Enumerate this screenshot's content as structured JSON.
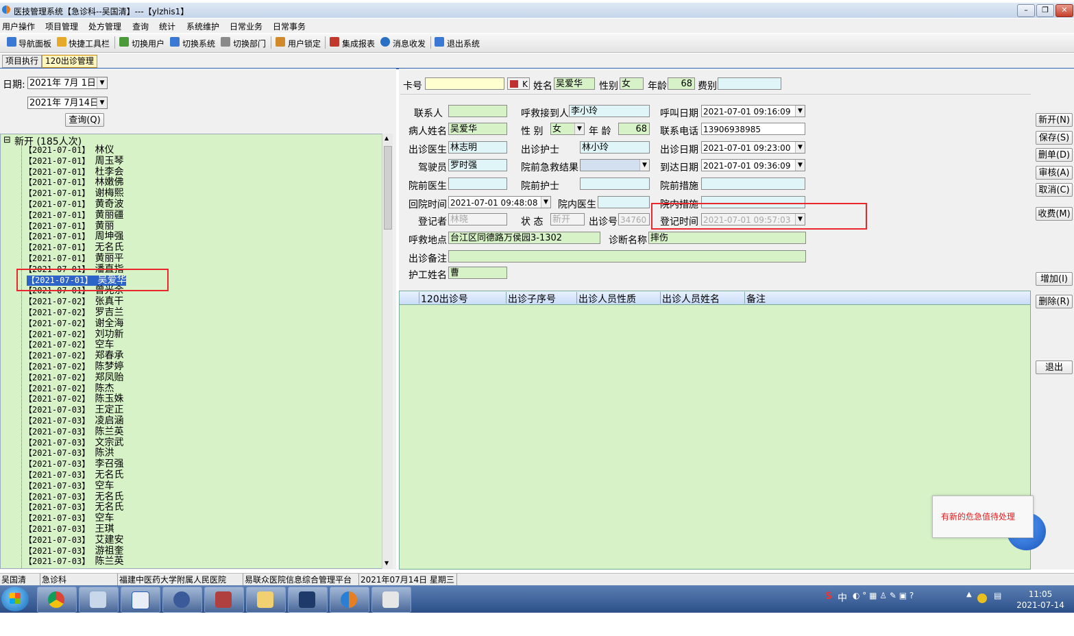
{
  "window": {
    "title": "医技管理系统【急诊科--吴国清】---【ylzhis1】"
  },
  "menu": [
    "用户操作",
    "项目管理",
    "处方管理",
    "查询",
    "统计",
    "系统维护",
    "日常业务",
    "日常事务"
  ],
  "toolbar": [
    "导航面板",
    "快捷工具栏",
    "切换用户",
    "切换系统",
    "切换部门",
    "用户锁定",
    "集成报表",
    "消息收发",
    "退出系统"
  ],
  "tabs": [
    "项目执行",
    "120出诊管理"
  ],
  "filter": {
    "date_label": "日期:",
    "date_from": "2021年 7月 1日",
    "date_to": "2021年 7月14日",
    "query_button": "查询(Q)"
  },
  "tree": {
    "root": "新开  (185人次)",
    "items": [
      {
        "date": "【2021-07-01】",
        "name": "林仪"
      },
      {
        "date": "【2021-07-01】",
        "name": "周玉琴"
      },
      {
        "date": "【2021-07-01】",
        "name": "杜李会"
      },
      {
        "date": "【2021-07-01】",
        "name": "林嫩佛"
      },
      {
        "date": "【2021-07-01】",
        "name": "谢梅熙"
      },
      {
        "date": "【2021-07-01】",
        "name": "黄奇波"
      },
      {
        "date": "【2021-07-01】",
        "name": "黄丽疆"
      },
      {
        "date": "【2021-07-01】",
        "name": "黄丽"
      },
      {
        "date": "【2021-07-01】",
        "name": "周坤强"
      },
      {
        "date": "【2021-07-01】",
        "name": "无名氏"
      },
      {
        "date": "【2021-07-01】",
        "name": "黄丽平"
      },
      {
        "date": "【2021-07-01】",
        "name": "潘直指"
      },
      {
        "date": "【2021-07-01】",
        "name": "吴爱华"
      },
      {
        "date": "【2021-07-01】",
        "name": "曾光余"
      },
      {
        "date": "【2021-07-02】",
        "name": "张真干"
      },
      {
        "date": "【2021-07-02】",
        "name": "罗吉兰"
      },
      {
        "date": "【2021-07-02】",
        "name": "谢全海"
      },
      {
        "date": "【2021-07-02】",
        "name": "刘功新"
      },
      {
        "date": "【2021-07-02】",
        "name": "空车"
      },
      {
        "date": "【2021-07-02】",
        "name": "郑春承"
      },
      {
        "date": "【2021-07-02】",
        "name": "陈梦婷"
      },
      {
        "date": "【2021-07-02】",
        "name": "郑凤贻"
      },
      {
        "date": "【2021-07-02】",
        "name": "陈杰"
      },
      {
        "date": "【2021-07-02】",
        "name": "陈玉姝"
      },
      {
        "date": "【2021-07-03】",
        "name": "王定正"
      },
      {
        "date": "【2021-07-03】",
        "name": "凌启涵"
      },
      {
        "date": "【2021-07-03】",
        "name": "陈兰英"
      },
      {
        "date": "【2021-07-03】",
        "name": "文宗武"
      },
      {
        "date": "【2021-07-03】",
        "name": "陈洪"
      },
      {
        "date": "【2021-07-03】",
        "name": "李召强"
      },
      {
        "date": "【2021-07-03】",
        "name": "无名氏"
      },
      {
        "date": "【2021-07-03】",
        "name": "空车"
      },
      {
        "date": "【2021-07-03】",
        "name": "无名氏"
      },
      {
        "date": "【2021-07-03】",
        "name": "无名氏"
      },
      {
        "date": "【2021-07-03】",
        "name": "空车"
      },
      {
        "date": "【2021-07-03】",
        "name": "王琪"
      },
      {
        "date": "【2021-07-03】",
        "name": "艾建安"
      },
      {
        "date": "【2021-07-03】",
        "name": "游祖奎"
      },
      {
        "date": "【2021-07-03】",
        "name": "陈兰英"
      }
    ]
  },
  "form": {
    "card_label": "卡号",
    "card_value": "",
    "k_label": "K",
    "name_label": "姓名",
    "name_value": "吴爱华",
    "gender_label": "性别",
    "gender_value": "女",
    "age_label": "年龄",
    "age_value": "68",
    "fee_label": "费别",
    "fee_value": "",
    "contact_label": "联系人",
    "contact_value": "",
    "receiver_label": "呼救接到人",
    "receiver_value": "李小玲",
    "call_date_label": "呼叫日期",
    "call_date_value": "2021-07-01 09:16:09",
    "patient_name_label": "病人姓名",
    "patient_name_value": "吴爱华",
    "sex_label": "性 别",
    "sex_value": "女",
    "age2_label": "年 龄",
    "age2_value": "68",
    "phone_label": "联系电话",
    "phone_value": "13906938985",
    "doctor_label": "出诊医生",
    "doctor_value": "林志明",
    "nurse_label": "出诊护士",
    "nurse_value": "林小玲",
    "visit_date_label": "出诊日期",
    "visit_date_value": "2021-07-01 09:23:00",
    "driver_label": "驾驶员",
    "driver_value": "罗时强",
    "result_label": "院前急救结果",
    "result_value": "",
    "arrive_label": "到达日期",
    "arrive_value": "2021-07-01 09:36:09",
    "pre_doctor_label": "院前医生",
    "pre_doctor_value": "",
    "pre_nurse_label": "院前护士",
    "pre_nurse_value": "",
    "pre_measure_label": "院前措施",
    "pre_measure_value": "",
    "return_label": "回院时间",
    "return_value": "2021-07-01 09:48:08",
    "in_doctor_label": "院内医生",
    "in_doctor_value": "",
    "in_measure_label": "院内措施",
    "in_measure_value": "",
    "registrar_label": "登记者",
    "registrar_value": "林晓",
    "status_label": "状 态",
    "status_value": "新开",
    "visit_no_label": "出诊号",
    "visit_no_value": "34760",
    "reg_time_label": "登记时间",
    "reg_time_value": "2021-07-01 09:57:03",
    "address_label": "呼救地点",
    "address_value": "台江区同德路万侯园3-1302",
    "diagnosis_label": "诊断名称",
    "diagnosis_value": "摔伤",
    "remark_label": "出诊备注",
    "remark_value": "",
    "worker_label": "护工姓名",
    "worker_value": "曹"
  },
  "grid": {
    "headers": [
      "120出诊号",
      "出诊子序号",
      "出诊人员性质",
      "出诊人员姓名",
      "备注"
    ]
  },
  "side_buttons": [
    "新开(N)",
    "保存(S)",
    "删单(D)",
    "审核(A)",
    "取消(C)",
    "收费(M)",
    "增加(I)",
    "删除(R)",
    "退出"
  ],
  "notification": "有新的危急值待处理",
  "bubble_letter": "S",
  "statusbar": [
    "吴国清",
    "急诊科",
    "福建中医药大学附属人民医院",
    "易联众医院信息综合管理平台",
    "2021年07月14日 星期三"
  ],
  "clock": {
    "time": "11:05",
    "date": "2021-07-14"
  },
  "tray_text": "中"
}
